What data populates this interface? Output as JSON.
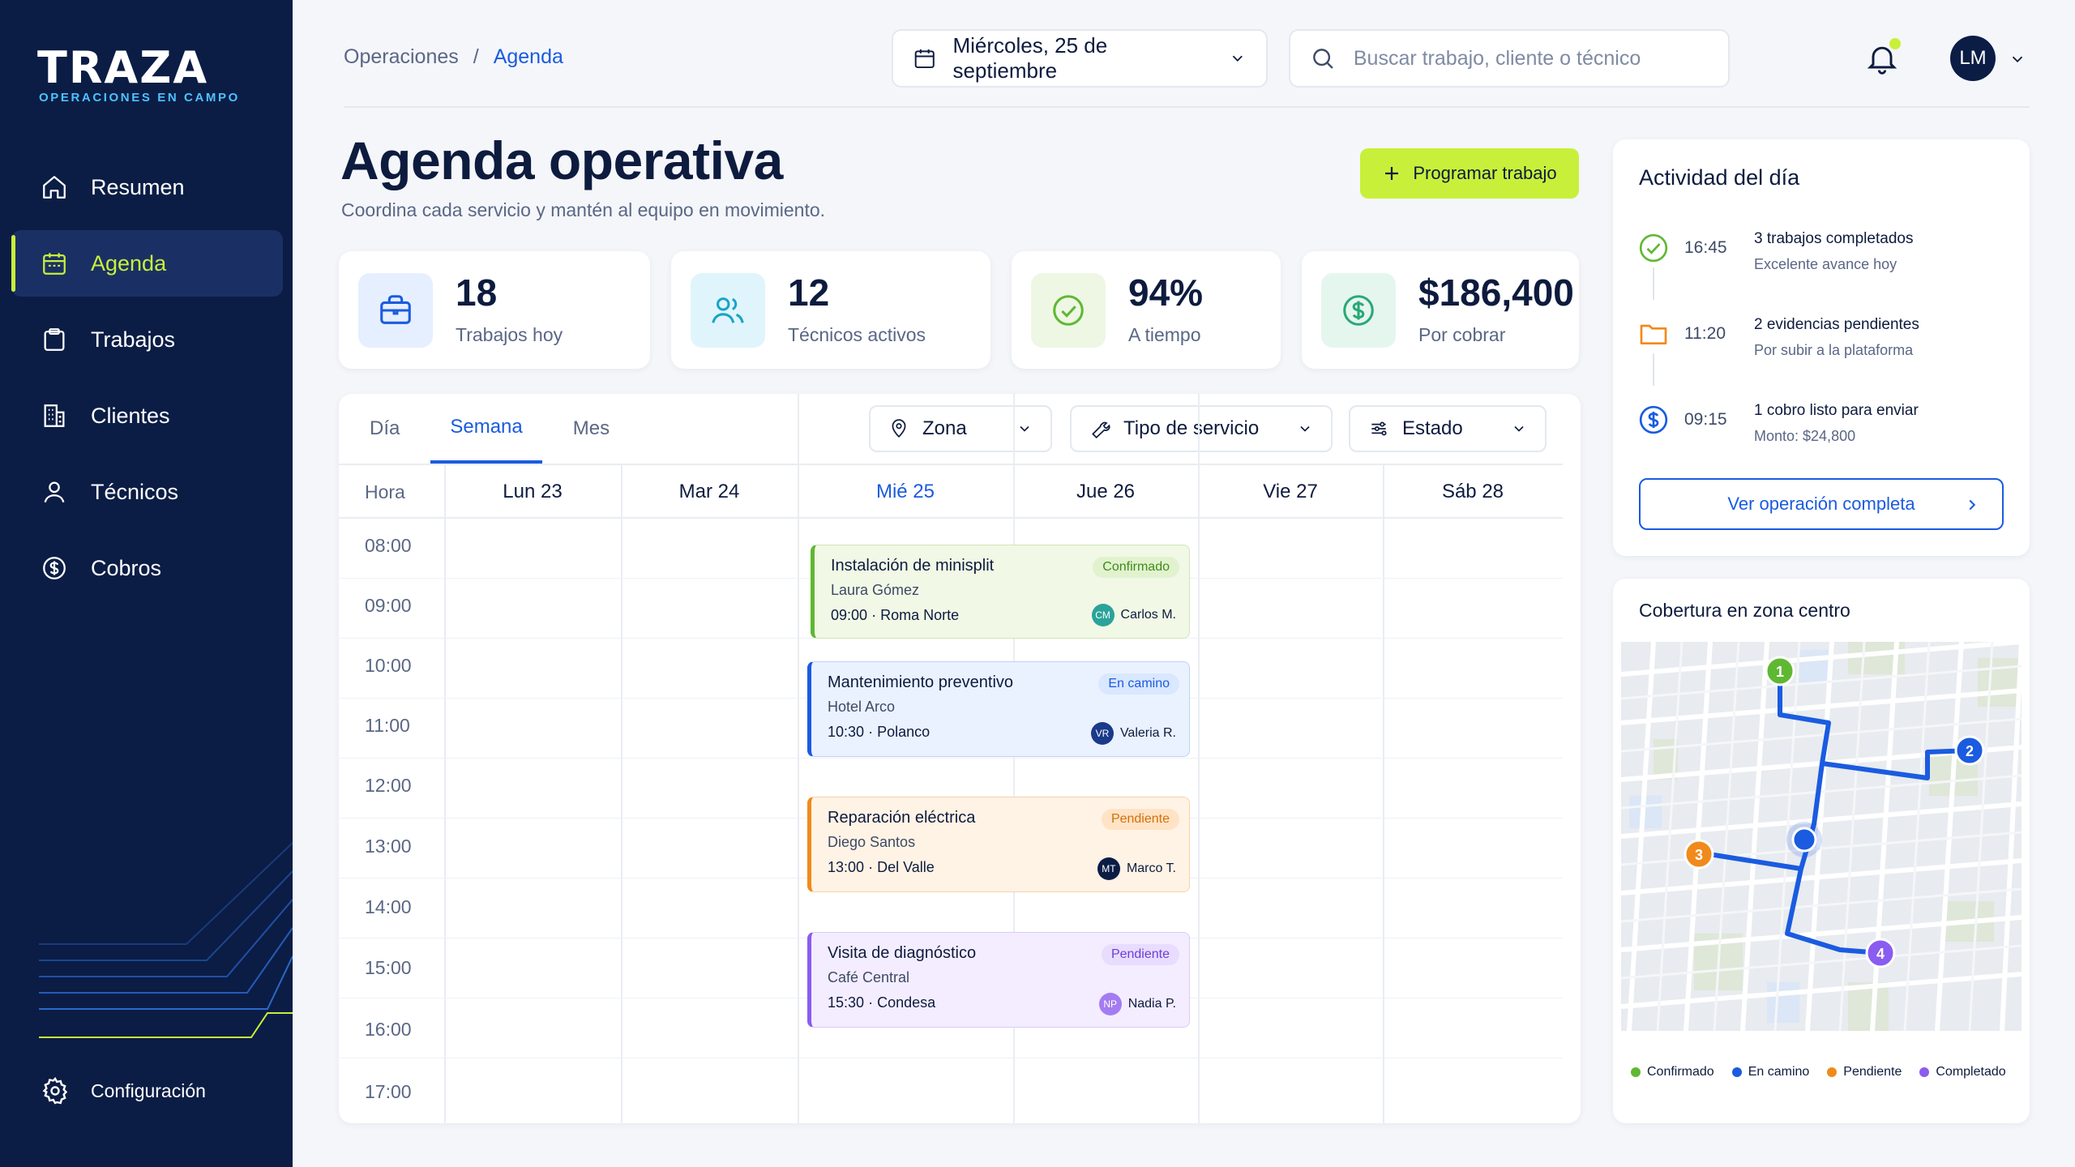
{
  "brand": {
    "name": "TRAZA",
    "tagline": "OPERACIONES EN CAMPO"
  },
  "sidebar": {
    "items": [
      {
        "label": "Resumen",
        "icon": "home-icon"
      },
      {
        "label": "Agenda",
        "icon": "calendar-icon",
        "active": true
      },
      {
        "label": "Trabajos",
        "icon": "clipboard-icon"
      },
      {
        "label": "Clientes",
        "icon": "building-icon"
      },
      {
        "label": "Técnicos",
        "icon": "user-icon"
      },
      {
        "label": "Cobros",
        "icon": "dollar-circle-icon"
      }
    ],
    "settings_label": "Configuración"
  },
  "header": {
    "breadcrumb": [
      "Operaciones",
      "/",
      "Agenda"
    ],
    "date": "Miércoles, 25 de septiembre",
    "search_placeholder": "Buscar trabajo, cliente o técnico",
    "avatar_initials": "LM"
  },
  "page": {
    "title": "Agenda operativa",
    "subtitle": "Coordina cada servicio y mantén al equipo en movimiento.",
    "primary_button": "Programar trabajo"
  },
  "kpis": [
    {
      "value": "18",
      "label": "Trabajos hoy",
      "icon": "briefcase-icon"
    },
    {
      "value": "12",
      "label": "Técnicos activos",
      "icon": "users-icon"
    },
    {
      "value": "94%",
      "label": "A tiempo",
      "icon": "check-circle-icon"
    },
    {
      "value": "$186,400",
      "label": "Por cobrar",
      "icon": "dollar-circle-icon"
    }
  ],
  "calendar": {
    "tabs": [
      "Día",
      "Semana",
      "Mes"
    ],
    "active_tab": "Semana",
    "filters": [
      "Zona",
      "Tipo de servicio",
      "Estado"
    ],
    "hour_header": "Hora",
    "days": [
      "Lun 23",
      "Mar 24",
      "Mié 25",
      "Jue 26",
      "Vie 27",
      "Sáb 28"
    ],
    "today": "Mié 25",
    "hours": [
      "08:00",
      "09:00",
      "10:00",
      "11:00",
      "12:00",
      "13:00",
      "14:00",
      "15:00",
      "16:00",
      "17:00"
    ],
    "events": [
      {
        "title": "Instalación de minisplit",
        "client": "Laura Gómez",
        "time": "09:00",
        "sep": "·",
        "zone": "Roma Norte",
        "status": "Confirmado",
        "tech_initials": "CM",
        "tech": "Carlos M."
      },
      {
        "title": "Mantenimiento preventivo",
        "client": "Hotel Arco",
        "time": "10:30",
        "sep": "·",
        "zone": "Polanco",
        "status": "En camino",
        "tech_initials": "VR",
        "tech": "Valeria R."
      },
      {
        "title": "Reparación eléctrica",
        "client": "Diego Santos",
        "time": "13:00",
        "sep": "·",
        "zone": "Del Valle",
        "status": "Pendiente",
        "tech_initials": "MT",
        "tech": "Marco T."
      },
      {
        "title": "Visita de diagnóstico",
        "client": "Café Central",
        "time": "15:30",
        "sep": "·",
        "zone": "Condesa",
        "status": "Pendiente",
        "tech_initials": "NP",
        "tech": "Nadia P."
      }
    ]
  },
  "activity": {
    "title": "Actividad del día",
    "items": [
      {
        "time": "16:45",
        "title": "3 trabajos completados",
        "detail": "Excelente avance hoy",
        "icon": "check-circle-icon"
      },
      {
        "time": "11:20",
        "title": "2 evidencias pendientes",
        "detail": "Por subir a la plataforma",
        "icon": "folder-icon"
      },
      {
        "time": "09:15",
        "title": "1 cobro listo para enviar",
        "detail": "Monto: $24,800",
        "icon": "dollar-circle-icon"
      }
    ],
    "button": "Ver operación completa"
  },
  "map": {
    "title": "Cobertura en zona centro",
    "markers": [
      "1",
      "2",
      "3",
      "4"
    ],
    "legend": [
      {
        "label": "Confirmado",
        "color": "#5fb832"
      },
      {
        "label": "En camino",
        "color": "#1a5be0"
      },
      {
        "label": "Pendiente",
        "color": "#f08a1c"
      },
      {
        "label": "Completado",
        "color": "#8a5cf0"
      }
    ]
  },
  "colors": {
    "sidebar_bg": "#0b1d45",
    "accent_lime": "#c8f03a",
    "accent_blue": "#1a5be0",
    "status_confirmed": "#5fb832",
    "status_on_route": "#1a5be0",
    "status_pending": "#f08a1c",
    "status_completed": "#8a5cf0"
  }
}
